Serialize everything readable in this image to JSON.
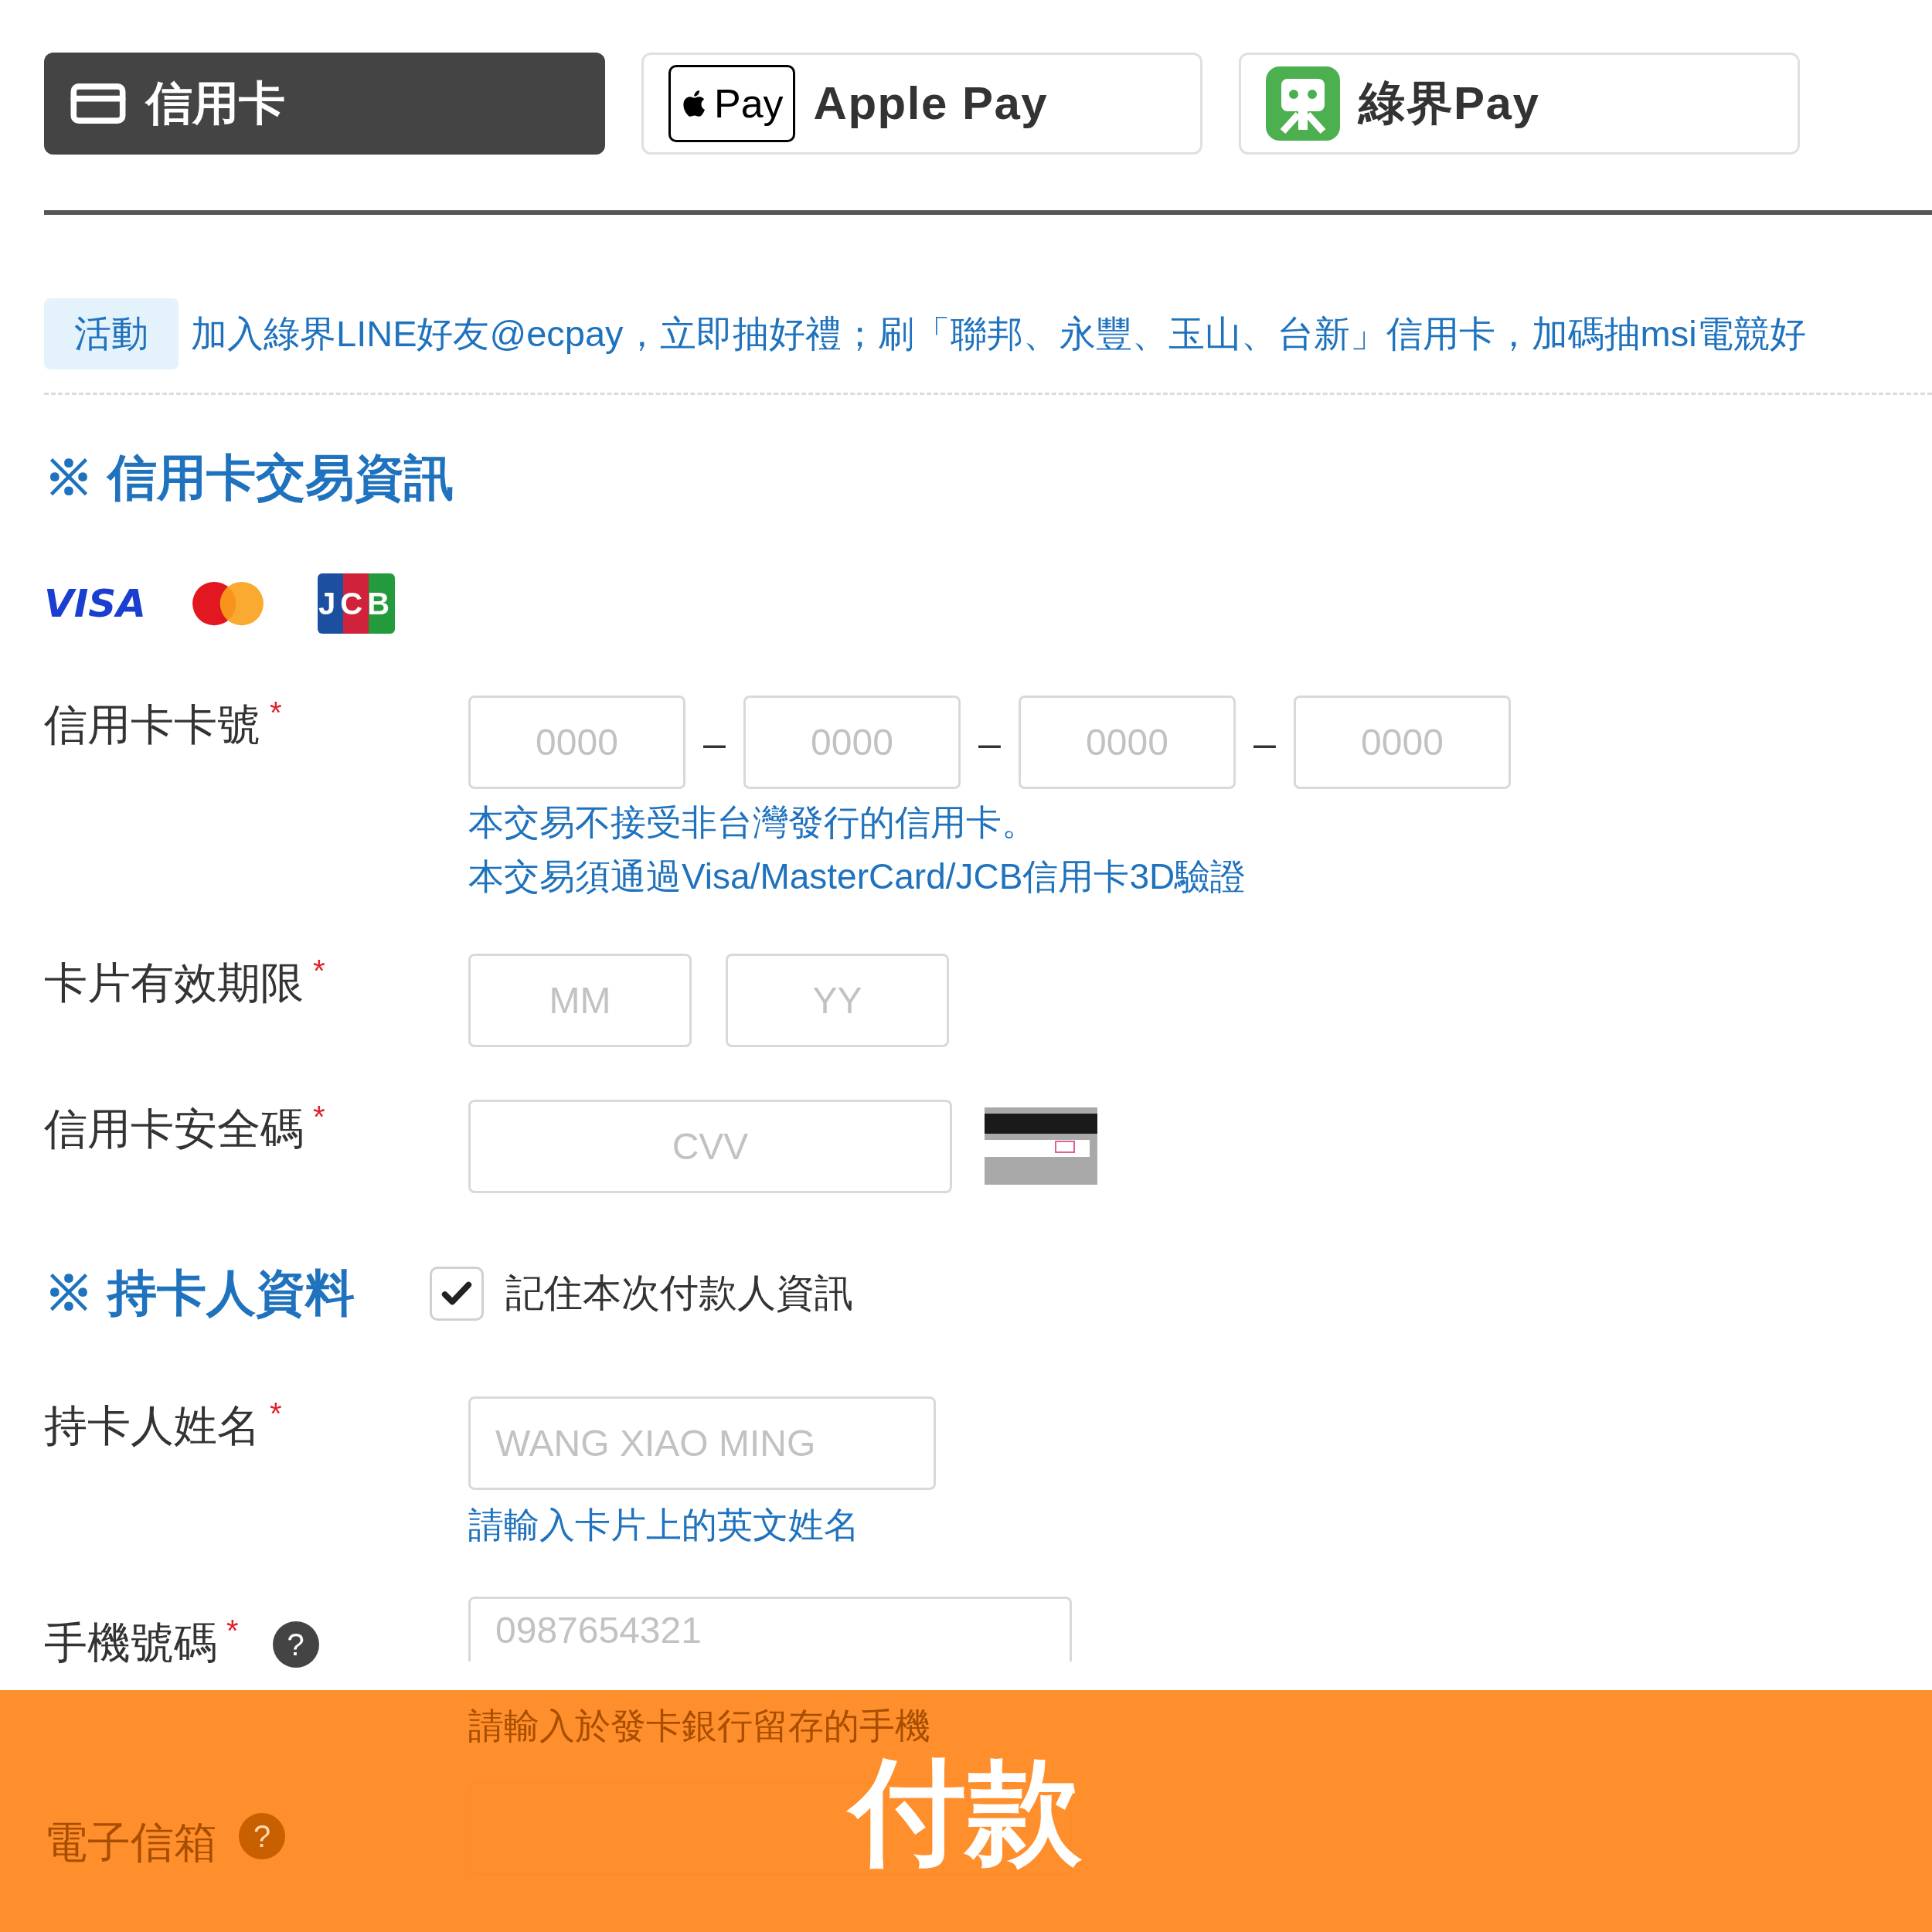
{
  "payment_tabs": [
    {
      "kind": "card",
      "label": "信用卡",
      "selected": true
    },
    {
      "kind": "applepay",
      "badge": "Pay",
      "label": "Apple Pay",
      "selected": false
    },
    {
      "kind": "ecpay",
      "label": "綠界Pay",
      "selected": false
    }
  ],
  "promo": {
    "tag": "活動",
    "text": "加入綠界LINE好友@ecpay，立即抽好禮；刷「聯邦、永豐、玉山、台新」信用卡，加碼抽msi電競好"
  },
  "card_section": {
    "marker": "※",
    "title": "信用卡交易資訊"
  },
  "card_logos": [
    {
      "kind": "visa",
      "text": "VISA"
    },
    {
      "kind": "mastercard"
    },
    {
      "kind": "jcb",
      "text": "JCB"
    }
  ],
  "card_number": {
    "label": "信用卡卡號",
    "mark": "*",
    "placeholders": [
      "0000",
      "0000",
      "0000",
      "0000"
    ],
    "separator": "–",
    "hints": [
      "本交易不接受非台灣發行的信用卡。",
      "本交易須通過Visa/MasterCard/JCB信用卡3D驗證"
    ]
  },
  "expiry": {
    "label": "卡片有效期限",
    "mark": "*",
    "placeholders": [
      "MM",
      "YY"
    ]
  },
  "cvv": {
    "label": "信用卡安全碼",
    "mark": "*",
    "placeholder": "CVV"
  },
  "holder_section": {
    "marker": "※",
    "title": "持卡人資料",
    "remember": {
      "label": "記住本次付款人資訊",
      "checked": true
    }
  },
  "holder_name": {
    "label": "持卡人姓名",
    "mark": "*",
    "placeholder": "WANG XIAO MING",
    "hint": "請輸入卡片上的英文姓名"
  },
  "phone": {
    "label": "手機號碼",
    "mark": "*",
    "help": "?",
    "placeholder": "0987654321",
    "hint": "請輸入於發卡銀行留存的手機"
  },
  "email": {
    "label": "電子信箱",
    "help": "?"
  },
  "pay_button": {
    "label": "付款"
  }
}
